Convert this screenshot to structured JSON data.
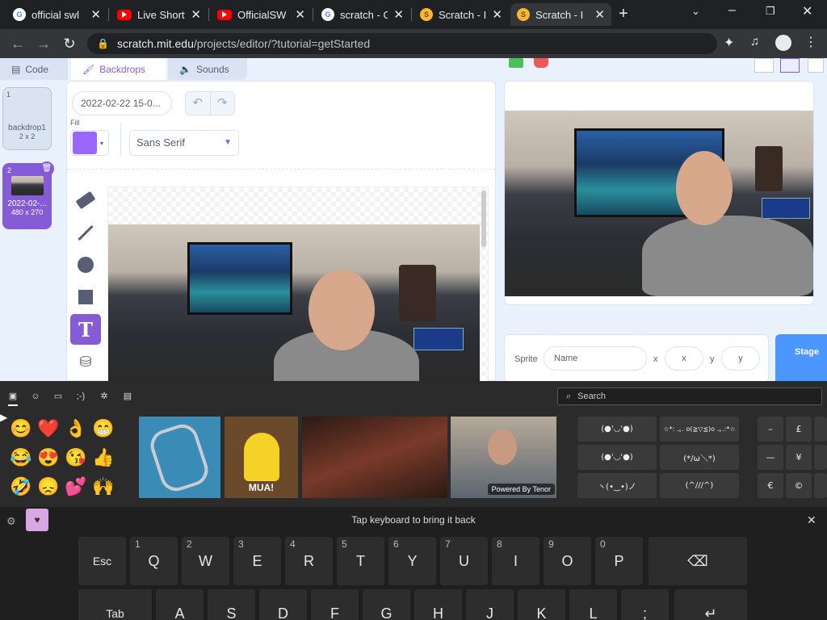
{
  "browser": {
    "tabs": [
      {
        "title": "official swl",
        "favicon": "google-icon"
      },
      {
        "title": "Live Shortw",
        "favicon": "youtube-icon"
      },
      {
        "title": "OfficialSWL",
        "favicon": "youtube-icon"
      },
      {
        "title": "scratch - G",
        "favicon": "google-icon"
      },
      {
        "title": "Scratch - Im",
        "favicon": "scratch-icon"
      },
      {
        "title": "Scratch - Im",
        "favicon": "scratch-icon"
      }
    ],
    "url_domain": "scratch.mit.edu",
    "url_path": "/projects/editor/?tutorial=getStarted"
  },
  "scratch": {
    "tabs": {
      "code": "Code",
      "backdrops": "Backdrops",
      "sounds": "Sounds"
    },
    "backdrops": [
      {
        "number": "1",
        "name": "backdrop1",
        "size": "2 x 2"
      },
      {
        "number": "2",
        "name": "2022-02-...",
        "size": "480 x 270"
      }
    ],
    "costume_name": "2022-02-22 15-0...",
    "fill_label": "Fill",
    "fill_color": "#9966ff",
    "font": "Sans Serif",
    "sprite": {
      "label": "Sprite",
      "name_placeholder": "Name",
      "x_label": "x",
      "x_placeholder": "x",
      "y_label": "y",
      "y_placeholder": "y"
    },
    "stage_label": "Stage"
  },
  "emoji_panel": {
    "search_placeholder": "Search",
    "emojis": [
      "😊",
      "❤️",
      "👌",
      "😁",
      "😂",
      "😍",
      "😘",
      "👍",
      "🤣",
      "😞",
      "💕",
      "🙌"
    ],
    "gif_caption_mua": "MUA!",
    "gif_credit": "Powered By Tenor",
    "kaomoji": [
      "(●'◡'●)",
      "☆*: .｡. o(≧▽≦)o .｡.:*☆",
      "(●'◡'●)",
      "(*/ω＼*)",
      "ヽ(•‿•)ノ",
      "(^///^)"
    ],
    "symbols": [
      "–",
      "£",
      "—",
      "¥",
      "€",
      "©"
    ],
    "hint": "Tap keyboard to bring it back"
  },
  "keyboard": {
    "row1": [
      {
        "label": "Esc",
        "num": ""
      },
      {
        "label": "Q",
        "num": "1"
      },
      {
        "label": "W",
        "num": "2"
      },
      {
        "label": "E",
        "num": "3"
      },
      {
        "label": "R",
        "num": "4"
      },
      {
        "label": "T",
        "num": "5"
      },
      {
        "label": "Y",
        "num": "6"
      },
      {
        "label": "U",
        "num": "7"
      },
      {
        "label": "I",
        "num": "8"
      },
      {
        "label": "O",
        "num": "9"
      },
      {
        "label": "P",
        "num": "0"
      }
    ],
    "row2": [
      "Tab",
      "A",
      "S",
      "D",
      "F",
      "G",
      "H",
      "J",
      "K",
      "L"
    ]
  }
}
